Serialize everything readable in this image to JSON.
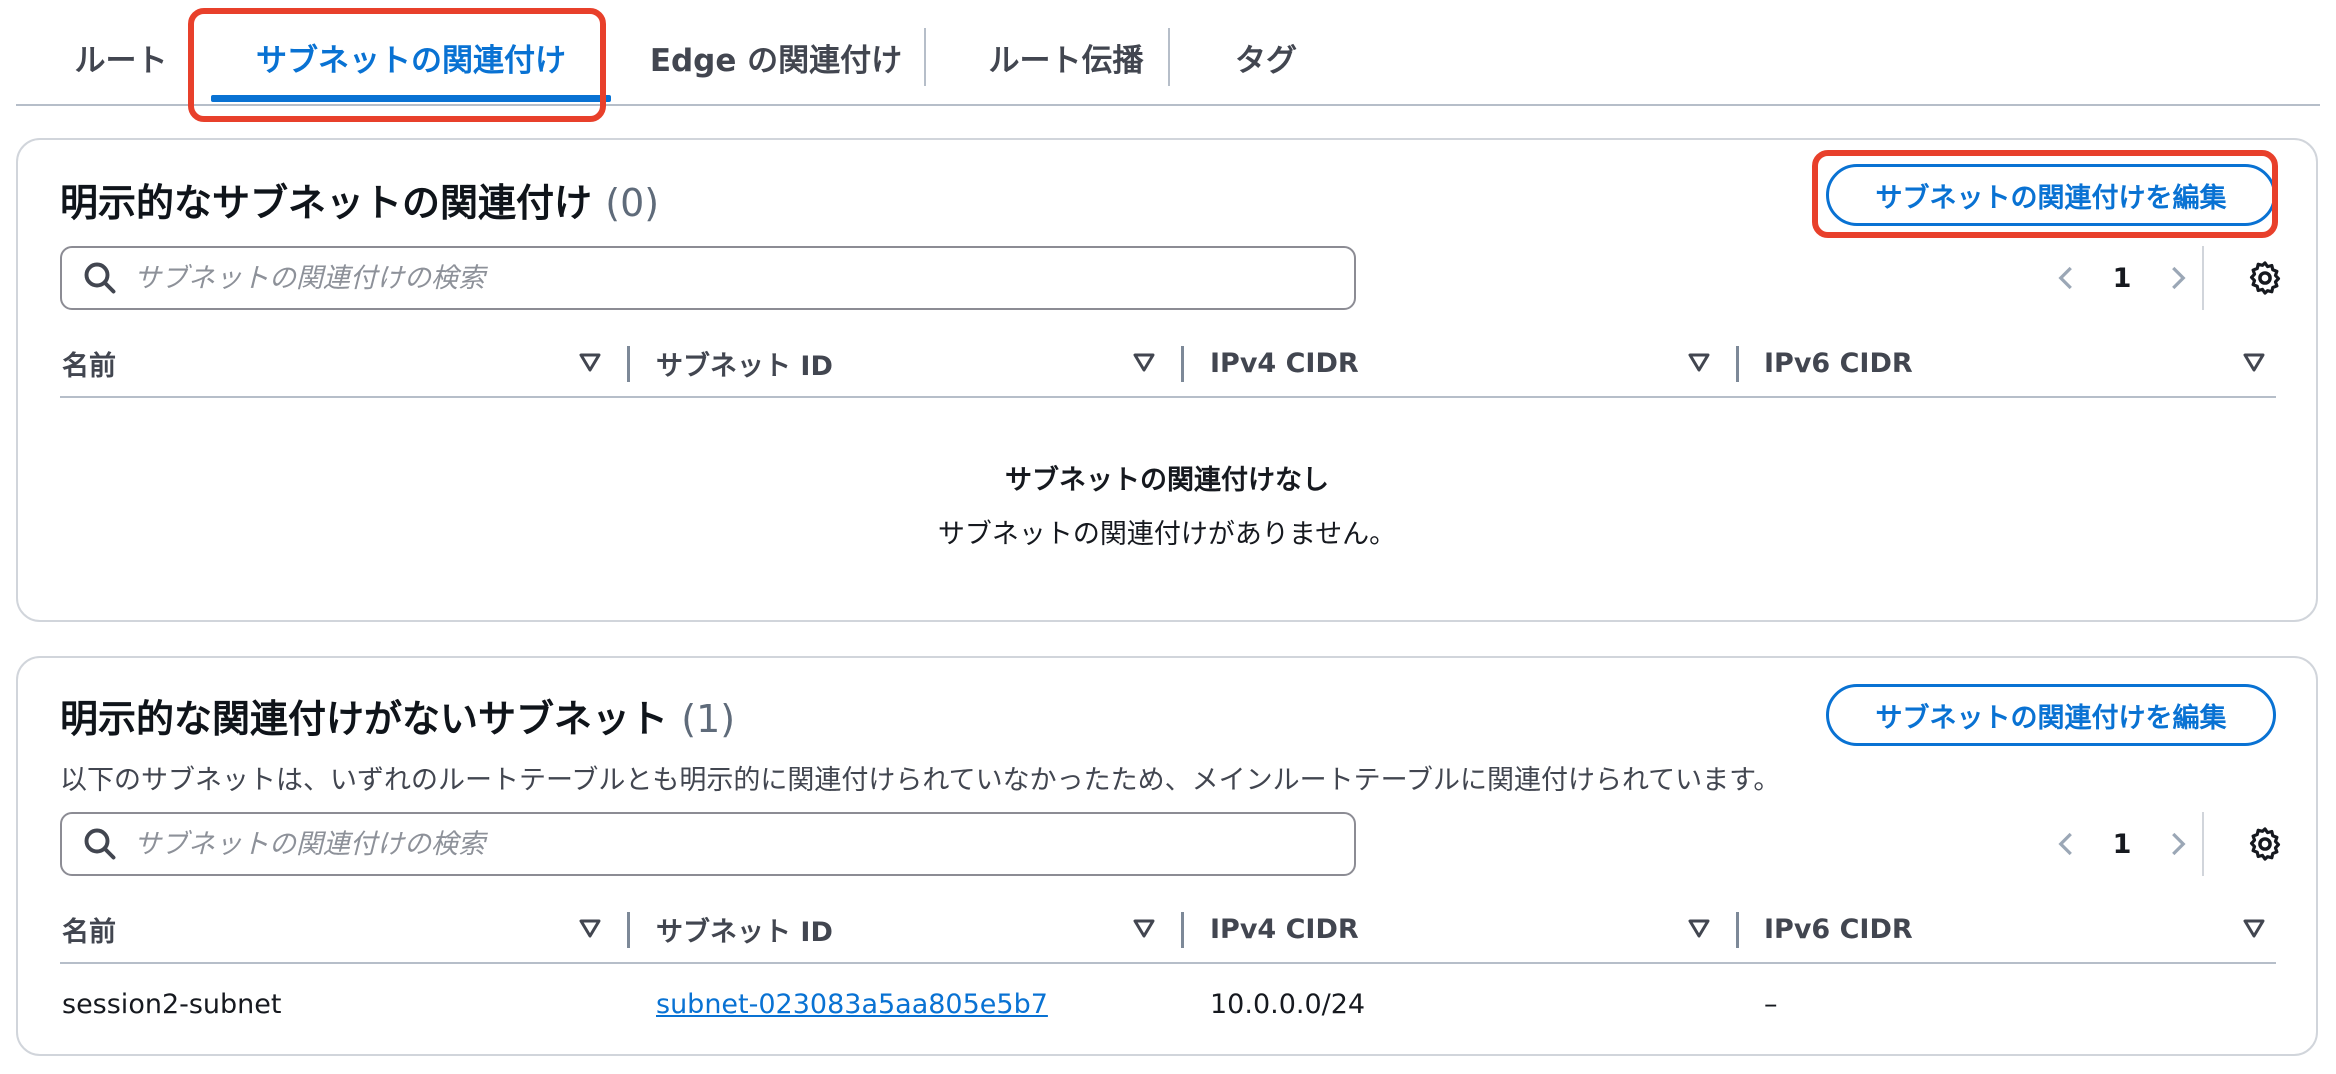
{
  "tabs": [
    {
      "label": "ルート"
    },
    {
      "label": "サブネットの関連付け"
    },
    {
      "label": "Edge の関連付け"
    },
    {
      "label": "ルート伝播"
    },
    {
      "label": "タグ"
    }
  ],
  "explicit": {
    "title": "明示的なサブネットの関連付け",
    "count": "(0)",
    "edit_button": "サブネットの関連付けを編集",
    "search_placeholder": "サブネットの関連付けの検索",
    "page": "1",
    "columns": [
      "名前",
      "サブネット ID",
      "IPv4 CIDR",
      "IPv6 CIDR"
    ],
    "empty_title": "サブネットの関連付けなし",
    "empty_desc": "サブネットの関連付けがありません。"
  },
  "implicit": {
    "title": "明示的な関連付けがないサブネット",
    "count": "(1)",
    "description": "以下のサブネットは、いずれのルートテーブルとも明示的に関連付けられていなかったため、メインルートテーブルに関連付けられています。",
    "edit_button": "サブネットの関連付けを編集",
    "search_placeholder": "サブネットの関連付けの検索",
    "page": "1",
    "columns": [
      "名前",
      "サブネット ID",
      "IPv4 CIDR",
      "IPv6 CIDR"
    ],
    "rows": [
      {
        "name": "session2-subnet",
        "subnet_id": "subnet-023083a5aa805e5b7",
        "ipv4": "10.0.0.0/24",
        "ipv6": "–"
      }
    ]
  },
  "colors": {
    "accent": "#0972d3",
    "highlight": "#e8402b"
  },
  "icons": {
    "search": "search-icon",
    "prev": "chevron-left-icon",
    "next": "chevron-right-icon",
    "settings": "gear-icon",
    "sort": "sort-down-icon"
  }
}
